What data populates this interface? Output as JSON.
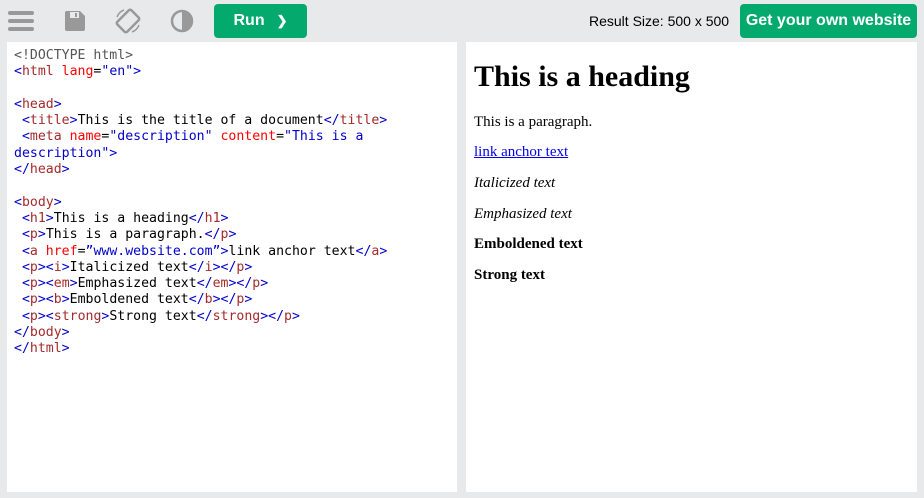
{
  "toolbar": {
    "icons": [
      "menu-icon",
      "save-icon",
      "rotate-icon",
      "contrast-icon"
    ],
    "run_label": "Run",
    "run_arrow": "❯",
    "result_size": "Result Size: 500 x 500",
    "own_website_label": "Get your own website"
  },
  "colors": {
    "accent": "#04aa6d",
    "bracket": "#0000cd",
    "tag": "#a52a2a",
    "attr": "#ff0000",
    "value": "#0000cd"
  },
  "code_lines": [
    [
      [
        "c",
        "<!DOCTYPE html>"
      ]
    ],
    [
      [
        "b",
        "<"
      ],
      [
        "t",
        "html"
      ],
      [
        "a",
        " lang"
      ],
      [
        "x",
        "="
      ],
      [
        "v",
        "\"en\""
      ],
      [
        "b",
        ">"
      ]
    ],
    [],
    [
      [
        "b",
        "<"
      ],
      [
        "t",
        "head"
      ],
      [
        "b",
        ">"
      ]
    ],
    [
      [
        "x",
        " "
      ],
      [
        "b",
        "<"
      ],
      [
        "t",
        "title"
      ],
      [
        "b",
        ">"
      ],
      [
        "x",
        "This is the title of a document"
      ],
      [
        "b",
        "</"
      ],
      [
        "t",
        "title"
      ],
      [
        "b",
        ">"
      ]
    ],
    [
      [
        "x",
        " "
      ],
      [
        "b",
        "<"
      ],
      [
        "t",
        "meta"
      ],
      [
        "a",
        " name"
      ],
      [
        "x",
        "="
      ],
      [
        "v",
        "\"description\""
      ],
      [
        "a",
        " content"
      ],
      [
        "x",
        "="
      ],
      [
        "v",
        "\"This is a"
      ]
    ],
    [
      [
        "v",
        "description\""
      ],
      [
        "b",
        ">"
      ]
    ],
    [
      [
        "b",
        "</"
      ],
      [
        "t",
        "head"
      ],
      [
        "b",
        ">"
      ]
    ],
    [],
    [
      [
        "b",
        "<"
      ],
      [
        "t",
        "body"
      ],
      [
        "b",
        ">"
      ]
    ],
    [
      [
        "x",
        " "
      ],
      [
        "b",
        "<"
      ],
      [
        "t",
        "h1"
      ],
      [
        "b",
        ">"
      ],
      [
        "x",
        "This is a heading"
      ],
      [
        "b",
        "</"
      ],
      [
        "t",
        "h1"
      ],
      [
        "b",
        ">"
      ]
    ],
    [
      [
        "x",
        " "
      ],
      [
        "b",
        "<"
      ],
      [
        "t",
        "p"
      ],
      [
        "b",
        ">"
      ],
      [
        "x",
        "This is a paragraph."
      ],
      [
        "b",
        "</"
      ],
      [
        "t",
        "p"
      ],
      [
        "b",
        ">"
      ]
    ],
    [
      [
        "x",
        " "
      ],
      [
        "b",
        "<"
      ],
      [
        "t",
        "a"
      ],
      [
        "a",
        " href"
      ],
      [
        "x",
        "="
      ],
      [
        "v",
        "”www.website.com”"
      ],
      [
        "b",
        ">"
      ],
      [
        "x",
        "link anchor text"
      ],
      [
        "b",
        "</"
      ],
      [
        "t",
        "a"
      ],
      [
        "b",
        ">"
      ]
    ],
    [
      [
        "x",
        " "
      ],
      [
        "b",
        "<"
      ],
      [
        "t",
        "p"
      ],
      [
        "b",
        "><"
      ],
      [
        "t",
        "i"
      ],
      [
        "b",
        ">"
      ],
      [
        "x",
        "Italicized text"
      ],
      [
        "b",
        "</"
      ],
      [
        "t",
        "i"
      ],
      [
        "b",
        "></"
      ],
      [
        "t",
        "p"
      ],
      [
        "b",
        ">"
      ]
    ],
    [
      [
        "x",
        " "
      ],
      [
        "b",
        "<"
      ],
      [
        "t",
        "p"
      ],
      [
        "b",
        "><"
      ],
      [
        "t",
        "em"
      ],
      [
        "b",
        ">"
      ],
      [
        "x",
        "Emphasized text"
      ],
      [
        "b",
        "</"
      ],
      [
        "t",
        "em"
      ],
      [
        "b",
        "></"
      ],
      [
        "t",
        "p"
      ],
      [
        "b",
        ">"
      ]
    ],
    [
      [
        "x",
        " "
      ],
      [
        "b",
        "<"
      ],
      [
        "t",
        "p"
      ],
      [
        "b",
        "><"
      ],
      [
        "t",
        "b"
      ],
      [
        "b",
        ">"
      ],
      [
        "x",
        "Emboldened text"
      ],
      [
        "b",
        "</"
      ],
      [
        "t",
        "b"
      ],
      [
        "b",
        "></"
      ],
      [
        "t",
        "p"
      ],
      [
        "b",
        ">"
      ]
    ],
    [
      [
        "x",
        " "
      ],
      [
        "b",
        "<"
      ],
      [
        "t",
        "p"
      ],
      [
        "b",
        "><"
      ],
      [
        "t",
        "strong"
      ],
      [
        "b",
        ">"
      ],
      [
        "x",
        "Strong text"
      ],
      [
        "b",
        "</"
      ],
      [
        "t",
        "strong"
      ],
      [
        "b",
        "></"
      ],
      [
        "t",
        "p"
      ],
      [
        "b",
        ">"
      ]
    ],
    [
      [
        "b",
        "</"
      ],
      [
        "t",
        "body"
      ],
      [
        "b",
        ">"
      ]
    ],
    [
      [
        "b",
        "</"
      ],
      [
        "t",
        "html"
      ],
      [
        "b",
        ">"
      ]
    ]
  ],
  "result": {
    "heading": "This is a heading",
    "paragraph": "This is a paragraph.",
    "link": "link anchor text",
    "italic": "Italicized text",
    "emphasized": "Emphasized text",
    "bold": "Emboldened text",
    "strong": "Strong text"
  }
}
